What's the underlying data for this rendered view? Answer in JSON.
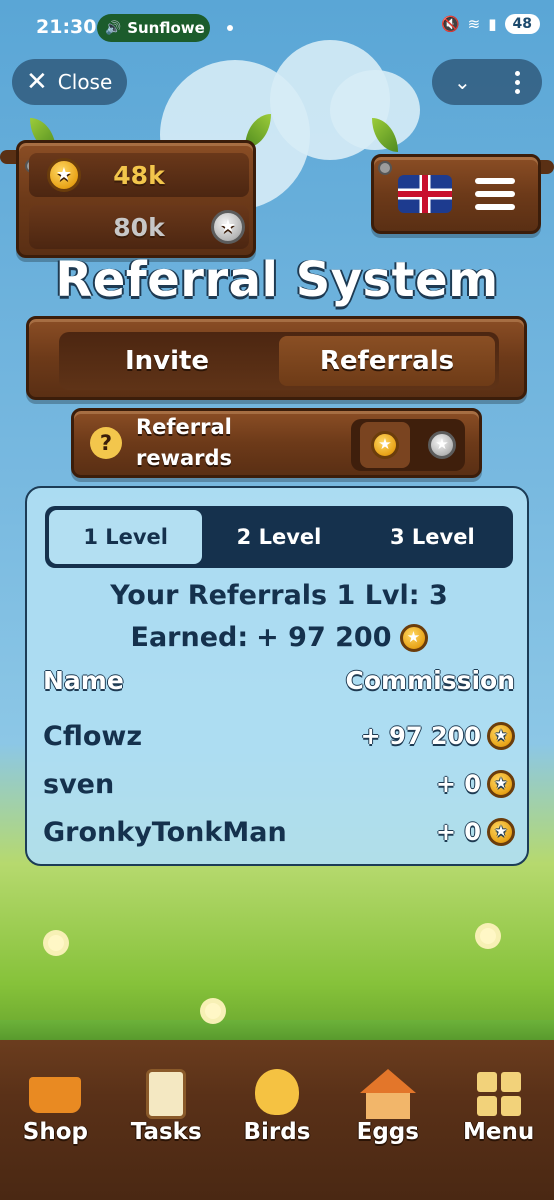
{
  "status_bar": {
    "time": "21:30",
    "media_label": "Sunflowe",
    "battery": "48"
  },
  "top_bar": {
    "close_label": "Close"
  },
  "balances": {
    "gold": "48k",
    "silver": "80k"
  },
  "page_title": "Referral System",
  "main_tabs": [
    {
      "label": "Invite",
      "active": false
    },
    {
      "label": "Referrals",
      "active": true
    }
  ],
  "rewards": {
    "label_line1": "Referral",
    "label_line2": "rewards",
    "help_glyph": "?"
  },
  "level_tabs": [
    {
      "label": "1 Level",
      "active": true
    },
    {
      "label": "2 Level",
      "active": false
    },
    {
      "label": "3 Level",
      "active": false
    }
  ],
  "summary": {
    "referrals_line": "Your Referrals 1 Lvl: 3",
    "earned_label": "Earned:",
    "earned_value": "+ 97 200"
  },
  "table": {
    "col_name": "Name",
    "col_commission": "Commission",
    "rows": [
      {
        "name": "Cflowz",
        "commission": "+ 97 200"
      },
      {
        "name": "sven",
        "commission": "+ 0"
      },
      {
        "name": "GronkyTonkMan",
        "commission": "+ 0"
      }
    ]
  },
  "bottom_nav": [
    {
      "label": "Shop",
      "icon": "cart-icon"
    },
    {
      "label": "Tasks",
      "icon": "clipboard-icon"
    },
    {
      "label": "Birds",
      "icon": "chick-icon"
    },
    {
      "label": "Eggs",
      "icon": "house-icon"
    },
    {
      "label": "Menu",
      "icon": "grid-icon"
    }
  ],
  "colors": {
    "sky": "#78b9e0",
    "wood": "#6d3a19",
    "navy": "#15314d",
    "gold": "#f3c64c"
  }
}
